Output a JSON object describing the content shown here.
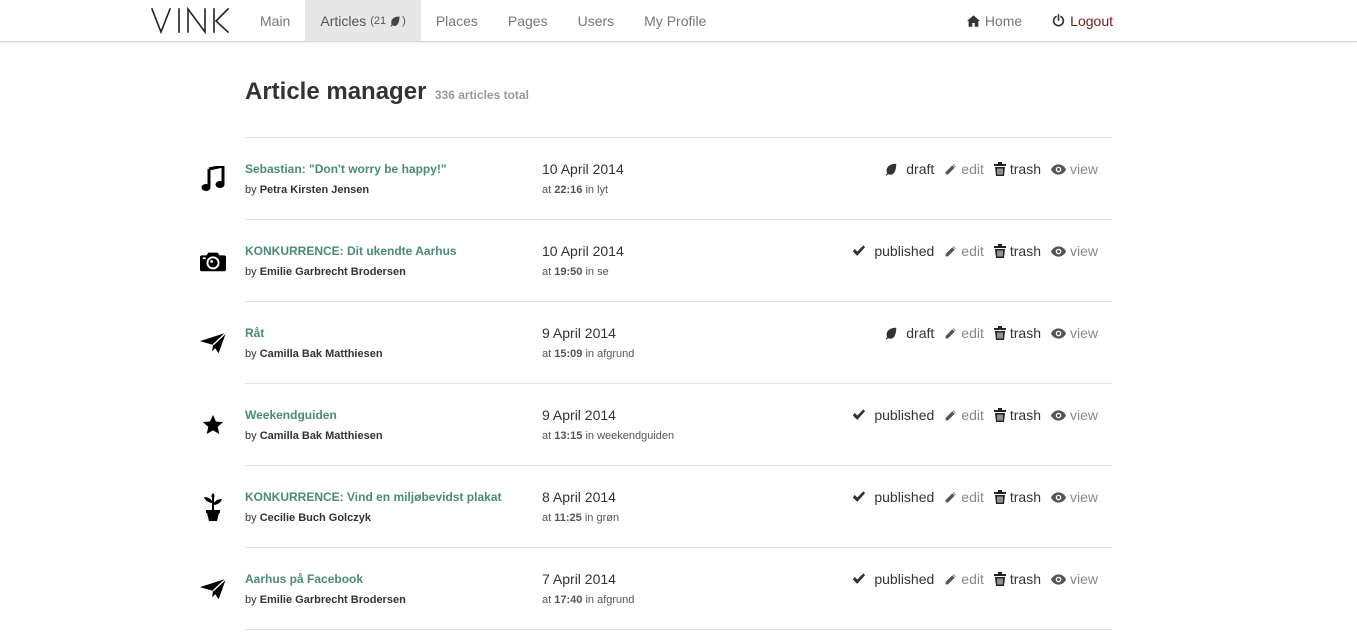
{
  "nav": {
    "logo_text": "VINK",
    "items": [
      {
        "label": "Main"
      },
      {
        "label": "Articles",
        "count_text": "(21",
        "count_close": ")"
      },
      {
        "label": "Places"
      },
      {
        "label": "Pages"
      },
      {
        "label": "Users"
      },
      {
        "label": "My Profile"
      }
    ],
    "home_label": "Home",
    "logout_label": "Logout"
  },
  "header": {
    "title": "Article manager",
    "subtitle": "336 articles total"
  },
  "articles": [
    {
      "icon": "music-note-icon",
      "title": "Sebastian: \"Don't worry be happy!\"",
      "by": "by",
      "author": "Petra Kirsten Jensen",
      "date": "10 April 2014",
      "at": "at",
      "time": "22:16",
      "in": "in",
      "category": "lyt",
      "status": "draft"
    },
    {
      "icon": "camera-icon",
      "title": "KONKURRENCE: Dit ukendte Aarhus",
      "by": "by",
      "author": "Emilie Garbrecht Brodersen",
      "date": "10 April 2014",
      "at": "at",
      "time": "19:50",
      "in": "in",
      "category": "se",
      "status": "published"
    },
    {
      "icon": "paper-plane-icon",
      "title": "Råt",
      "by": "by",
      "author": "Camilla Bak Matthiesen",
      "date": "9 April 2014",
      "at": "at",
      "time": "15:09",
      "in": "in",
      "category": "afgrund",
      "status": "draft"
    },
    {
      "icon": "star-icon",
      "title": "Weekendguiden",
      "by": "by",
      "author": "Camilla Bak Matthiesen",
      "date": "9 April 2014",
      "at": "at",
      "time": "13:15",
      "in": "in",
      "category": "weekendguiden",
      "status": "published"
    },
    {
      "icon": "plant-icon",
      "title": "KONKURRENCE: Vind en miljøbevidst plakat",
      "by": "by",
      "author": "Cecilie Buch Golczyk",
      "date": "8 April 2014",
      "at": "at",
      "time": "11:25",
      "in": "in",
      "category": "grøn",
      "status": "published"
    },
    {
      "icon": "paper-plane-icon",
      "title": "Aarhus på Facebook",
      "by": "by",
      "author": "Emilie Garbrecht Brodersen",
      "date": "7 April 2014",
      "at": "at",
      "time": "17:40",
      "in": "in",
      "category": "afgrund",
      "status": "published"
    }
  ],
  "actions": {
    "edit": "edit",
    "trash": "trash",
    "view": "view"
  },
  "colors": {
    "link": "#4a8a78",
    "logout": "#7a1a1a",
    "active_tab": "#e7e7e7"
  }
}
